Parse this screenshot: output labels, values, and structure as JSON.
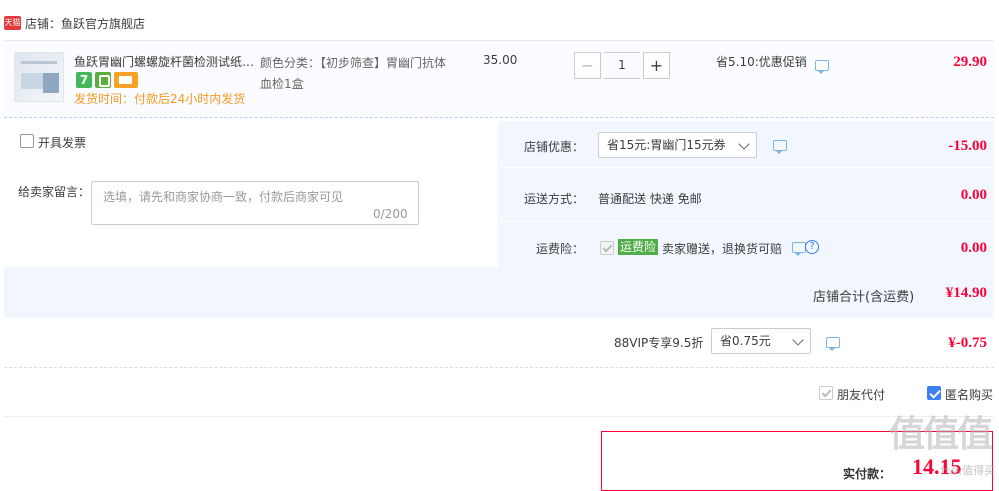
{
  "shop": {
    "badge": "天猫",
    "label": "店铺：鱼跃官方旗舰店"
  },
  "item": {
    "title": "鱼跃胃幽门螺螺旋杆菌检测试纸…",
    "tag_number": "7",
    "ship_time": "发货时间：付款后24小时内发货",
    "sku": "颜色分类：【初步筛查】胃幽门抗体血检1盒",
    "unit_price": "35.00",
    "qty_minus": "−",
    "qty": "1",
    "qty_plus": "+",
    "promo": "省5.10:优惠促销",
    "total": "29.90"
  },
  "invoice_label": "开具发票",
  "message": {
    "label": "给卖家留言：",
    "placeholder": "选填，请先和商家协商一致，付款后商家可见",
    "count": "0/200"
  },
  "shop_discount": {
    "label": "店铺优惠：",
    "selected": "省15元:胃幽门15元券",
    "amount": "-15.00"
  },
  "shipping": {
    "label": "运送方式：",
    "value": "普通配送 快递 免邮",
    "amount": "0.00"
  },
  "insurance": {
    "label": "运费险：",
    "tag": "运费险",
    "desc": "卖家赠送，退换货可赔",
    "q": "?",
    "amount": "0.00"
  },
  "shop_total": {
    "label": "店铺合计(含运费)",
    "amount": "¥14.90"
  },
  "vip": {
    "label": "88VIP专享9.5折",
    "selected": "省0.75元",
    "amount": "¥-0.75"
  },
  "options": {
    "friend_pay": "朋友代付",
    "anonymous": "匿名购买"
  },
  "final": {
    "label": "实付款：",
    "amount": "14.15"
  },
  "watermark": {
    "text": "值值值",
    "sub": "什么值得买"
  }
}
